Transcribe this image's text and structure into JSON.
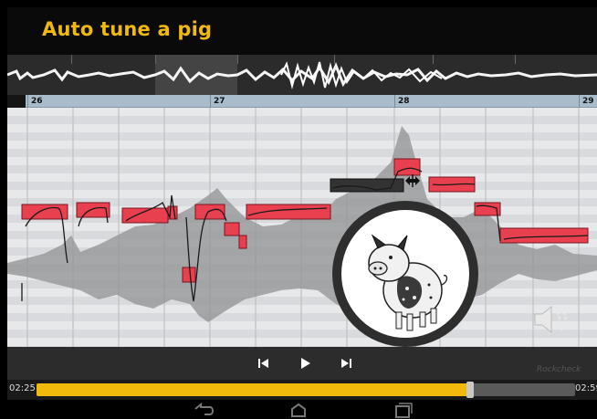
{
  "title": "Auto tune a pig",
  "ruler": {
    "markers": [
      "26",
      "27",
      "28",
      "29"
    ]
  },
  "icons": {
    "pig": "pig-illustration",
    "speaker": "speaker-volume-icon",
    "resize": "horizontal-resize-cursor-icon",
    "prev": "skip-previous-icon",
    "play": "play-icon",
    "next": "skip-next-icon",
    "back": "back-nav-icon",
    "home": "home-nav-icon",
    "recents": "recent-apps-nav-icon"
  },
  "player": {
    "current_time": "02:25",
    "total_time": "02:59",
    "progress": 0.805
  },
  "watermark": "Rockcheck",
  "colors": {
    "accent": "#f2b90d",
    "note_fill": "#e8404f",
    "note_selected": "#333333"
  }
}
